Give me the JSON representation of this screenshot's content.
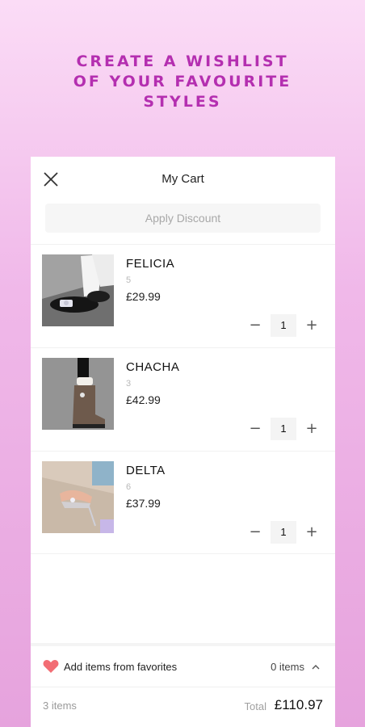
{
  "headline": {
    "line1": "CREATE A WISHLIST",
    "line2": "OF YOUR FAVOURITE",
    "line3": "STYLES"
  },
  "cart": {
    "title": "My Cart",
    "discount_label": "Apply Discount",
    "items": [
      {
        "name": "FELICIA",
        "size": "5",
        "price": "£29.99",
        "qty": "1"
      },
      {
        "name": "CHACHA",
        "size": "3",
        "price": "£42.99",
        "qty": "1"
      },
      {
        "name": "DELTA",
        "size": "6",
        "price": "£37.99",
        "qty": "1"
      }
    ],
    "favorites_label": "Add items from favorites",
    "favorites_count": "0 items",
    "items_count": "3 items",
    "total_label": "Total",
    "total_value": "£110.97"
  },
  "colors": {
    "headline": "#b42fb0",
    "heart": "#f26d74",
    "background_top": "#fbdcf6",
    "background_bottom": "#e6a3dd"
  }
}
